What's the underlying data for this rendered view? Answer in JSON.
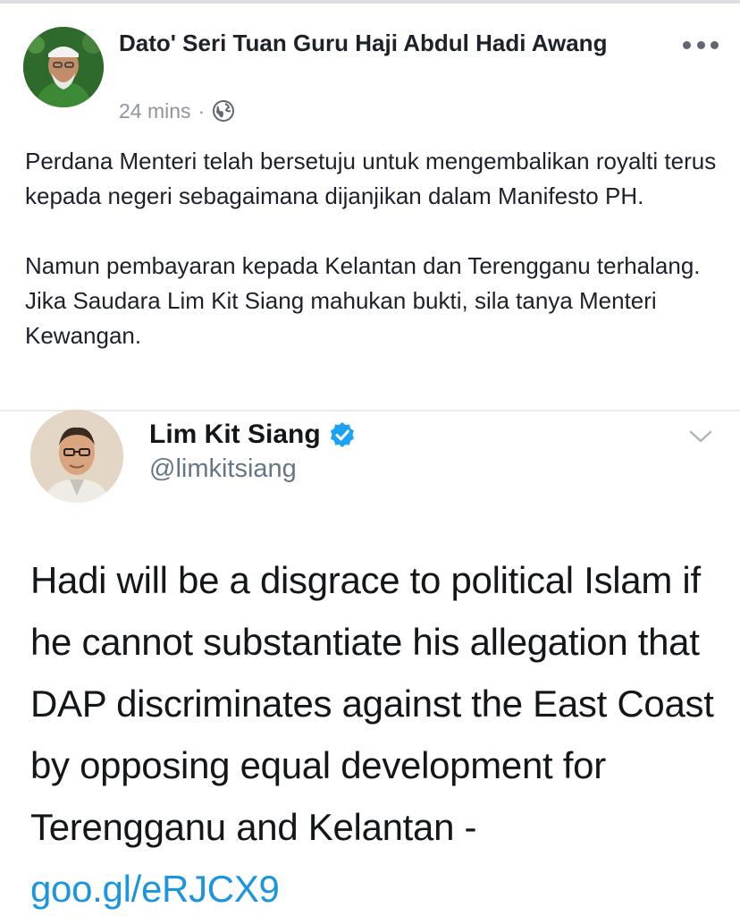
{
  "post": {
    "author": "Dato' Seri Tuan Guru Haji Abdul Hadi Awang",
    "timestamp": "24 mins",
    "separator": "·",
    "privacy_icon": "globe-icon",
    "menu_icon": "more-icon",
    "paragraphs": [
      "Perdana Menteri telah bersetuju untuk mengembalikan royalti terus kepada negeri sebagaimana dijanjikan dalam Manifesto PH.",
      "Namun pembayaran kepada Kelantan dan Terengganu terhalang. Jika Saudara Lim Kit Siang mahukan bukti, sila tanya Menteri Kewangan."
    ]
  },
  "tweet": {
    "name": "Lim Kit Siang",
    "verified_icon": "verified-badge-icon",
    "handle": "@limkitsiang",
    "menu_icon": "chevron-down-icon",
    "text": "Hadi will be a disgrace to political Islam if he cannot substantiate his allegation that DAP discriminates against the East Coast by opposing equal development for Terengganu and Kelantan - ",
    "link": "goo.gl/eRJCX9"
  },
  "colors": {
    "text_primary": "#1d2129",
    "text_secondary": "#90949c",
    "twitter_blue": "#1b95e0",
    "handle_gray": "#657786"
  }
}
